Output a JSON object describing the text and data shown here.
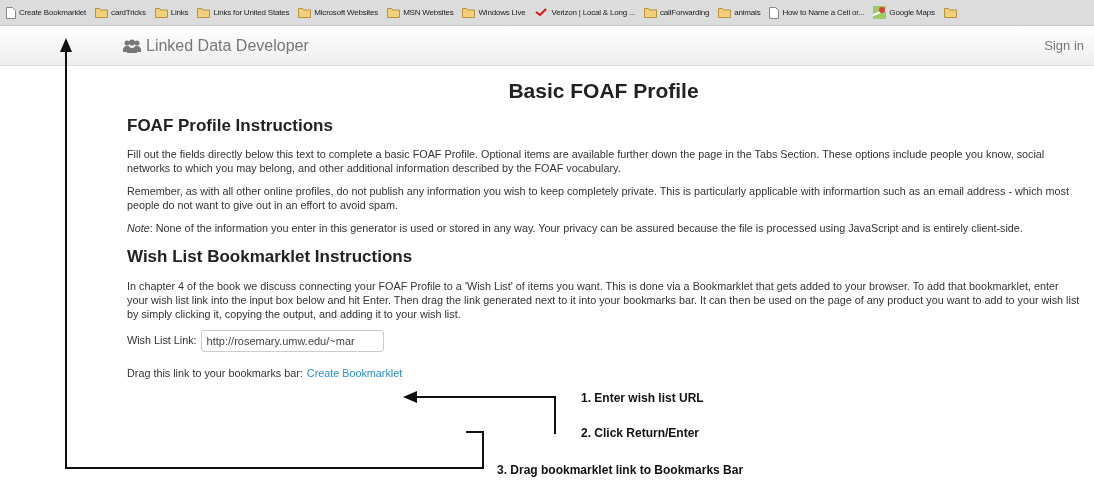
{
  "bookmarks": [
    {
      "kind": "page",
      "label": "Create Bookmarklet"
    },
    {
      "kind": "folder",
      "label": "cardTricks"
    },
    {
      "kind": "folder",
      "label": "Links"
    },
    {
      "kind": "folder",
      "label": "Links for United States"
    },
    {
      "kind": "folder",
      "label": "Microsoft Websites"
    },
    {
      "kind": "folder",
      "label": "MSN Websites"
    },
    {
      "kind": "folder",
      "label": "Windows Live"
    },
    {
      "kind": "site",
      "label": "Verizon | Local & Long ..."
    },
    {
      "kind": "folder",
      "label": "callForwarding"
    },
    {
      "kind": "folder",
      "label": "animals"
    },
    {
      "kind": "page",
      "label": "How to Name a Cell or..."
    },
    {
      "kind": "map",
      "label": "Google Maps"
    },
    {
      "kind": "folder"
    }
  ],
  "header": {
    "brand": "Linked Data Developer",
    "sign_in": "Sign in"
  },
  "title": "Basic FOAF Profile",
  "sections": [
    {
      "heading": "FOAF Profile Instructions",
      "paragraphs": [
        "Fill out the fields directly below this text to complete a basic FOAF Profile. Optional items are available further down the page in the Tabs Section. These options include people you know, social networks to which you may belong, and other additional information described by the FOAF vocabulary.",
        "Remember, as with all other online profiles, do not publish any information you wish to keep completely private. This is particularly applicable with informartion such as an email address - which most people do not want to give out in an effort to avoid spam.",
        "*Note*: None of the information you enter in this generator is used or stored in any way. Your privacy can be assured because the file is processed using JavaScript and is entirely client-side."
      ]
    },
    {
      "heading": "Wish List Bookmarklet Instructions",
      "paragraphs": [
        "In chapter 4 of the book we discuss connecting your FOAF Profile to a 'Wish List' of items you want. This is done via a Bookmarklet that gets added to your browser. To add that bookmarklet, enter your wish list link into the input box below and hit Enter. Then drag the link generated next to it into your bookmarks bar. It can then be used on the page of any product you want to add to your wish list by simply clicking it, copying the output, and adding it to your wish list."
      ]
    }
  ],
  "wish_list": {
    "label": "Wish List Link:",
    "value": "http://rosemary.umw.edu/~mar"
  },
  "drag": {
    "text": "Drag this link to your bookmarks bar:",
    "link": "Create Bookmarklet"
  },
  "annotations": [
    "1. Enter wish list URL",
    "2. Click Return/Enter",
    "3. Drag bookmarklet link to Bookmarks Bar"
  ]
}
